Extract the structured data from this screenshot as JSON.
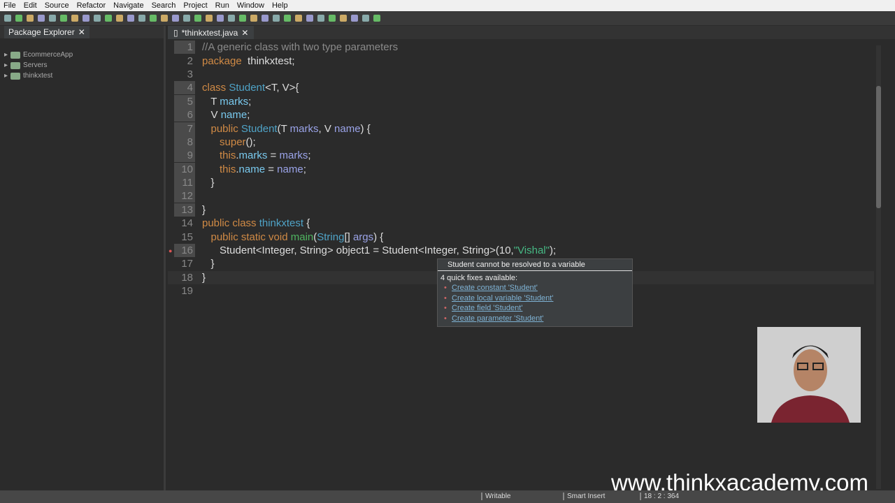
{
  "menu": [
    "File",
    "Edit",
    "Source",
    "Refactor",
    "Navigate",
    "Search",
    "Project",
    "Run",
    "Window",
    "Help"
  ],
  "package_explorer": {
    "title": "Package Explorer",
    "items": [
      "EcommerceApp",
      "Servers",
      "thinkxtest"
    ]
  },
  "editor": {
    "tab": "*thinkxtest.java"
  },
  "code": [
    {
      "n": "1",
      "hl": true,
      "t": [
        [
          "cmt",
          "//A generic class with two type parameters"
        ]
      ]
    },
    {
      "n": "2",
      "t": [
        [
          "kw",
          "package"
        ],
        [
          "",
          "  thinkxtest;"
        ]
      ]
    },
    {
      "n": "3",
      "t": []
    },
    {
      "n": "4",
      "hl": true,
      "t": [
        [
          "kw",
          "class "
        ],
        [
          "cls",
          "Student"
        ],
        [
          "",
          "<T, V>{"
        ]
      ]
    },
    {
      "n": "5",
      "hl": true,
      "t": [
        [
          "",
          "   T "
        ],
        [
          "fld",
          "marks"
        ],
        [
          "",
          ";"
        ]
      ]
    },
    {
      "n": "6",
      "hl": true,
      "t": [
        [
          "",
          "   V "
        ],
        [
          "fld",
          "name"
        ],
        [
          "",
          ";"
        ]
      ]
    },
    {
      "n": "7",
      "hl": true,
      "t": [
        [
          "kw",
          "   public "
        ],
        [
          "cls",
          "Student"
        ],
        [
          "",
          "(T "
        ],
        [
          "par",
          "marks"
        ],
        [
          "",
          ", V "
        ],
        [
          "par",
          "name"
        ],
        [
          "",
          ") {"
        ]
      ]
    },
    {
      "n": "8",
      "hl": true,
      "t": [
        [
          "kw",
          "      super"
        ],
        [
          "",
          "();"
        ]
      ]
    },
    {
      "n": "9",
      "hl": true,
      "t": [
        [
          "kw",
          "      this"
        ],
        [
          "",
          "."
        ],
        [
          "fld",
          "marks"
        ],
        [
          "",
          " = "
        ],
        [
          "par",
          "marks"
        ],
        [
          "",
          ";"
        ]
      ]
    },
    {
      "n": "10",
      "hl": true,
      "t": [
        [
          "kw",
          "      this"
        ],
        [
          "",
          "."
        ],
        [
          "fld",
          "name"
        ],
        [
          "",
          " = "
        ],
        [
          "par",
          "name"
        ],
        [
          "",
          ";"
        ]
      ]
    },
    {
      "n": "11",
      "hl": true,
      "t": [
        [
          "",
          "   }"
        ]
      ]
    },
    {
      "n": "12",
      "hl": true,
      "t": []
    },
    {
      "n": "13",
      "hl": true,
      "t": [
        [
          "",
          "}"
        ]
      ]
    },
    {
      "n": "14",
      "t": [
        [
          "kw",
          "public class "
        ],
        [
          "cls",
          "thinkxtest"
        ],
        [
          "",
          " {"
        ]
      ]
    },
    {
      "n": "15",
      "t": [
        [
          "kw",
          "   public static void "
        ],
        [
          "mth",
          "main"
        ],
        [
          "",
          "("
        ],
        [
          "cls",
          "String"
        ],
        [
          "",
          "[] "
        ],
        [
          "par",
          "args"
        ],
        [
          "",
          ") {"
        ]
      ]
    },
    {
      "n": "16",
      "hl": true,
      "t": [
        [
          "",
          "      Student<Integer, String> object1 = Student<Integer, String>(10,"
        ],
        [
          "str",
          "\"Vishal\""
        ],
        [
          "",
          ");"
        ]
      ]
    },
    {
      "n": "17",
      "t": [
        [
          "",
          "   }"
        ]
      ]
    },
    {
      "n": "18",
      "cur": true,
      "t": [
        [
          "",
          "}"
        ]
      ]
    },
    {
      "n": "19",
      "t": []
    }
  ],
  "quickfix": {
    "title": "Student cannot be resolved to a variable",
    "subtitle": "4 quick fixes available:",
    "fixes": [
      "Create constant 'Student'",
      "Create local variable 'Student'",
      "Create field 'Student'",
      "Create parameter 'Student'"
    ]
  },
  "status": {
    "writable": "Writable",
    "insert": "Smart Insert",
    "position": "18 : 2 : 364"
  },
  "watermark": "www.thinkxacademy.com"
}
